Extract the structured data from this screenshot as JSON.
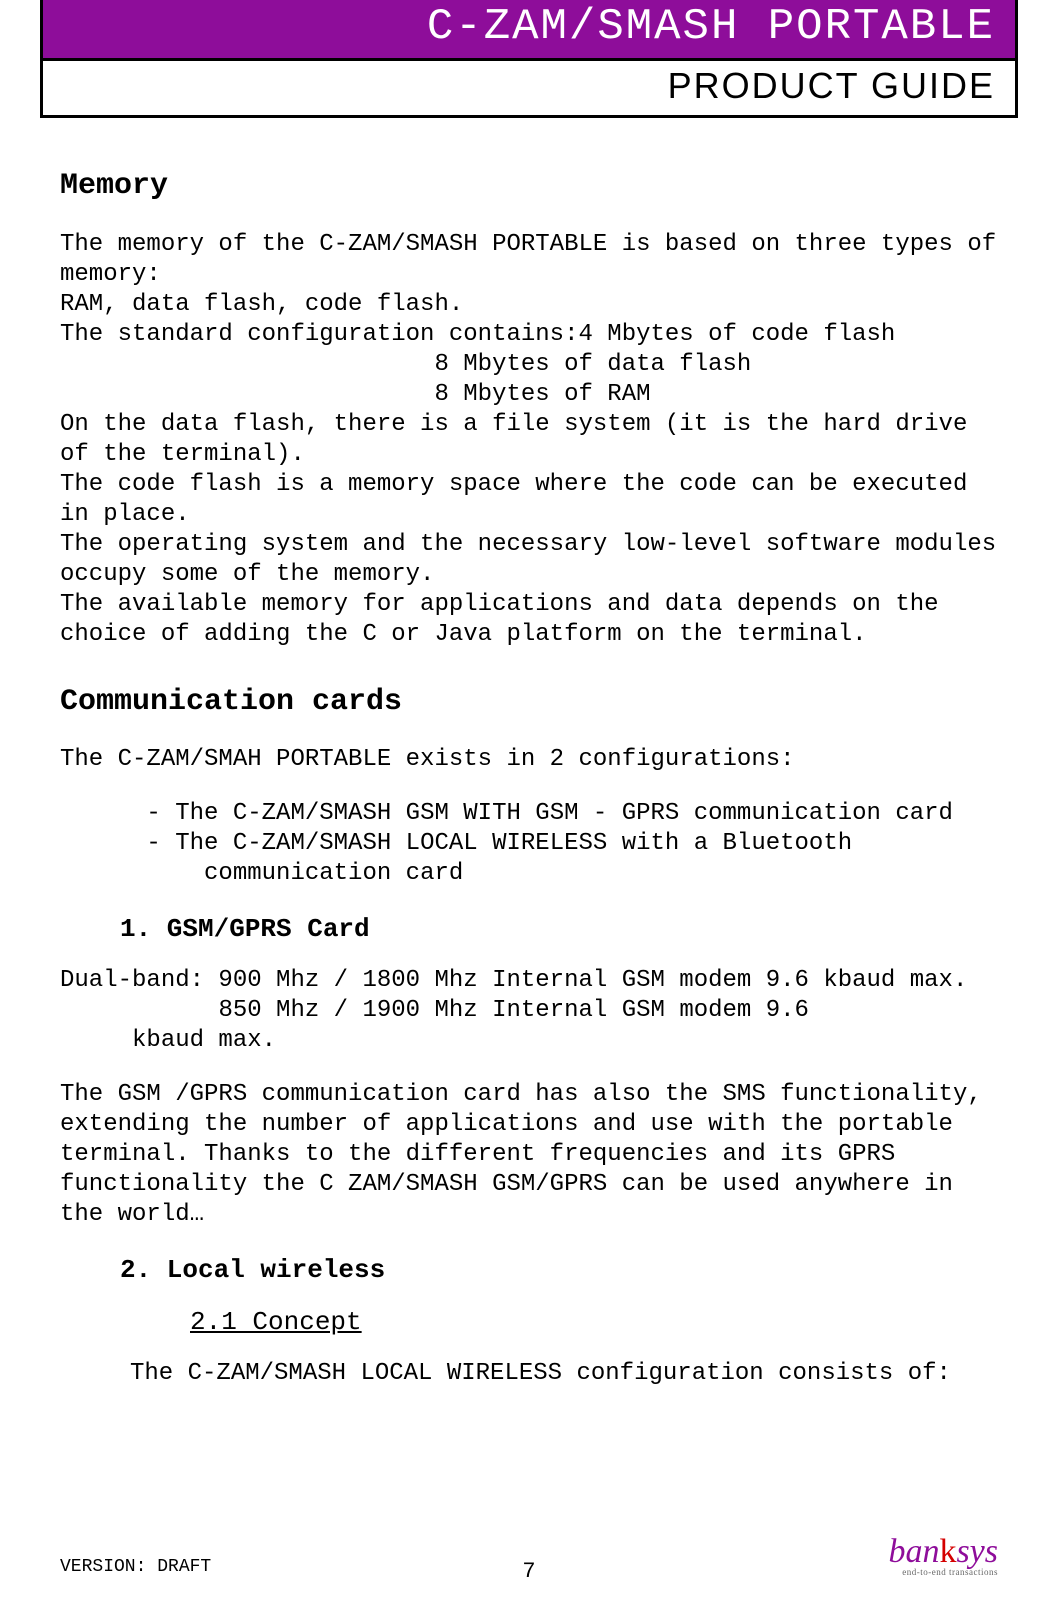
{
  "header": {
    "title_main": "C-ZAM/SMASH",
    "title_suffix": " PORTABLE",
    "subtitle": "PRODUCT GUIDE"
  },
  "sections": {
    "memory": {
      "heading": "Memory",
      "body": "The memory of the C-ZAM/SMASH PORTABLE is based on three types of memory:\nRAM, data flash, code flash.\nThe standard configuration contains:4 Mbytes of code flash\n                          8 Mbytes of data flash\n                          8 Mbytes of RAM\nOn the data flash, there is a file system (it is the hard drive of the terminal).\nThe code flash is a memory space where the code can be executed in place.\nThe operating system and the necessary low-level software modules occupy some of the memory.\nThe available memory for applications and data depends on the choice of adding the C or Java platform on the terminal."
    },
    "comm": {
      "heading": "Communication cards",
      "intro": "The C-ZAM/SMAH PORTABLE exists in 2 configurations:",
      "bullets": "      - The C-ZAM/SMASH GSM WITH GSM - GPRS communication card\n      - The C-ZAM/SMASH LOCAL WIRELESS with a Bluetooth\n          communication card",
      "sub1_heading": "1. GSM/GPRS Card",
      "sub1_body1": "Dual-band: 900 Mhz / 1800 Mhz Internal GSM modem 9.6 kbaud max.\n           850 Mhz / 1900 Mhz Internal GSM modem 9.6\n     kbaud max.",
      "sub1_body2": "The GSM /GPRS communication card has also the SMS functionality, extending the number of applications and use with the portable terminal. Thanks to the different frequencies and its GPRS functionality the C ZAM/SMASH GSM/GPRS can be used anywhere in the world…",
      "sub2_heading": "2. Local wireless",
      "sub2_sub_heading": "2.1 Concept",
      "sub2_body": "The C-ZAM/SMASH LOCAL WIRELESS configuration consists of:"
    }
  },
  "footer": {
    "page_number": "7",
    "version": "VERSION: DRAFT",
    "logo_text_pre": "ban",
    "logo_text_k": "k",
    "logo_text_post": "sys",
    "logo_tagline": "end-to-end transactions"
  }
}
